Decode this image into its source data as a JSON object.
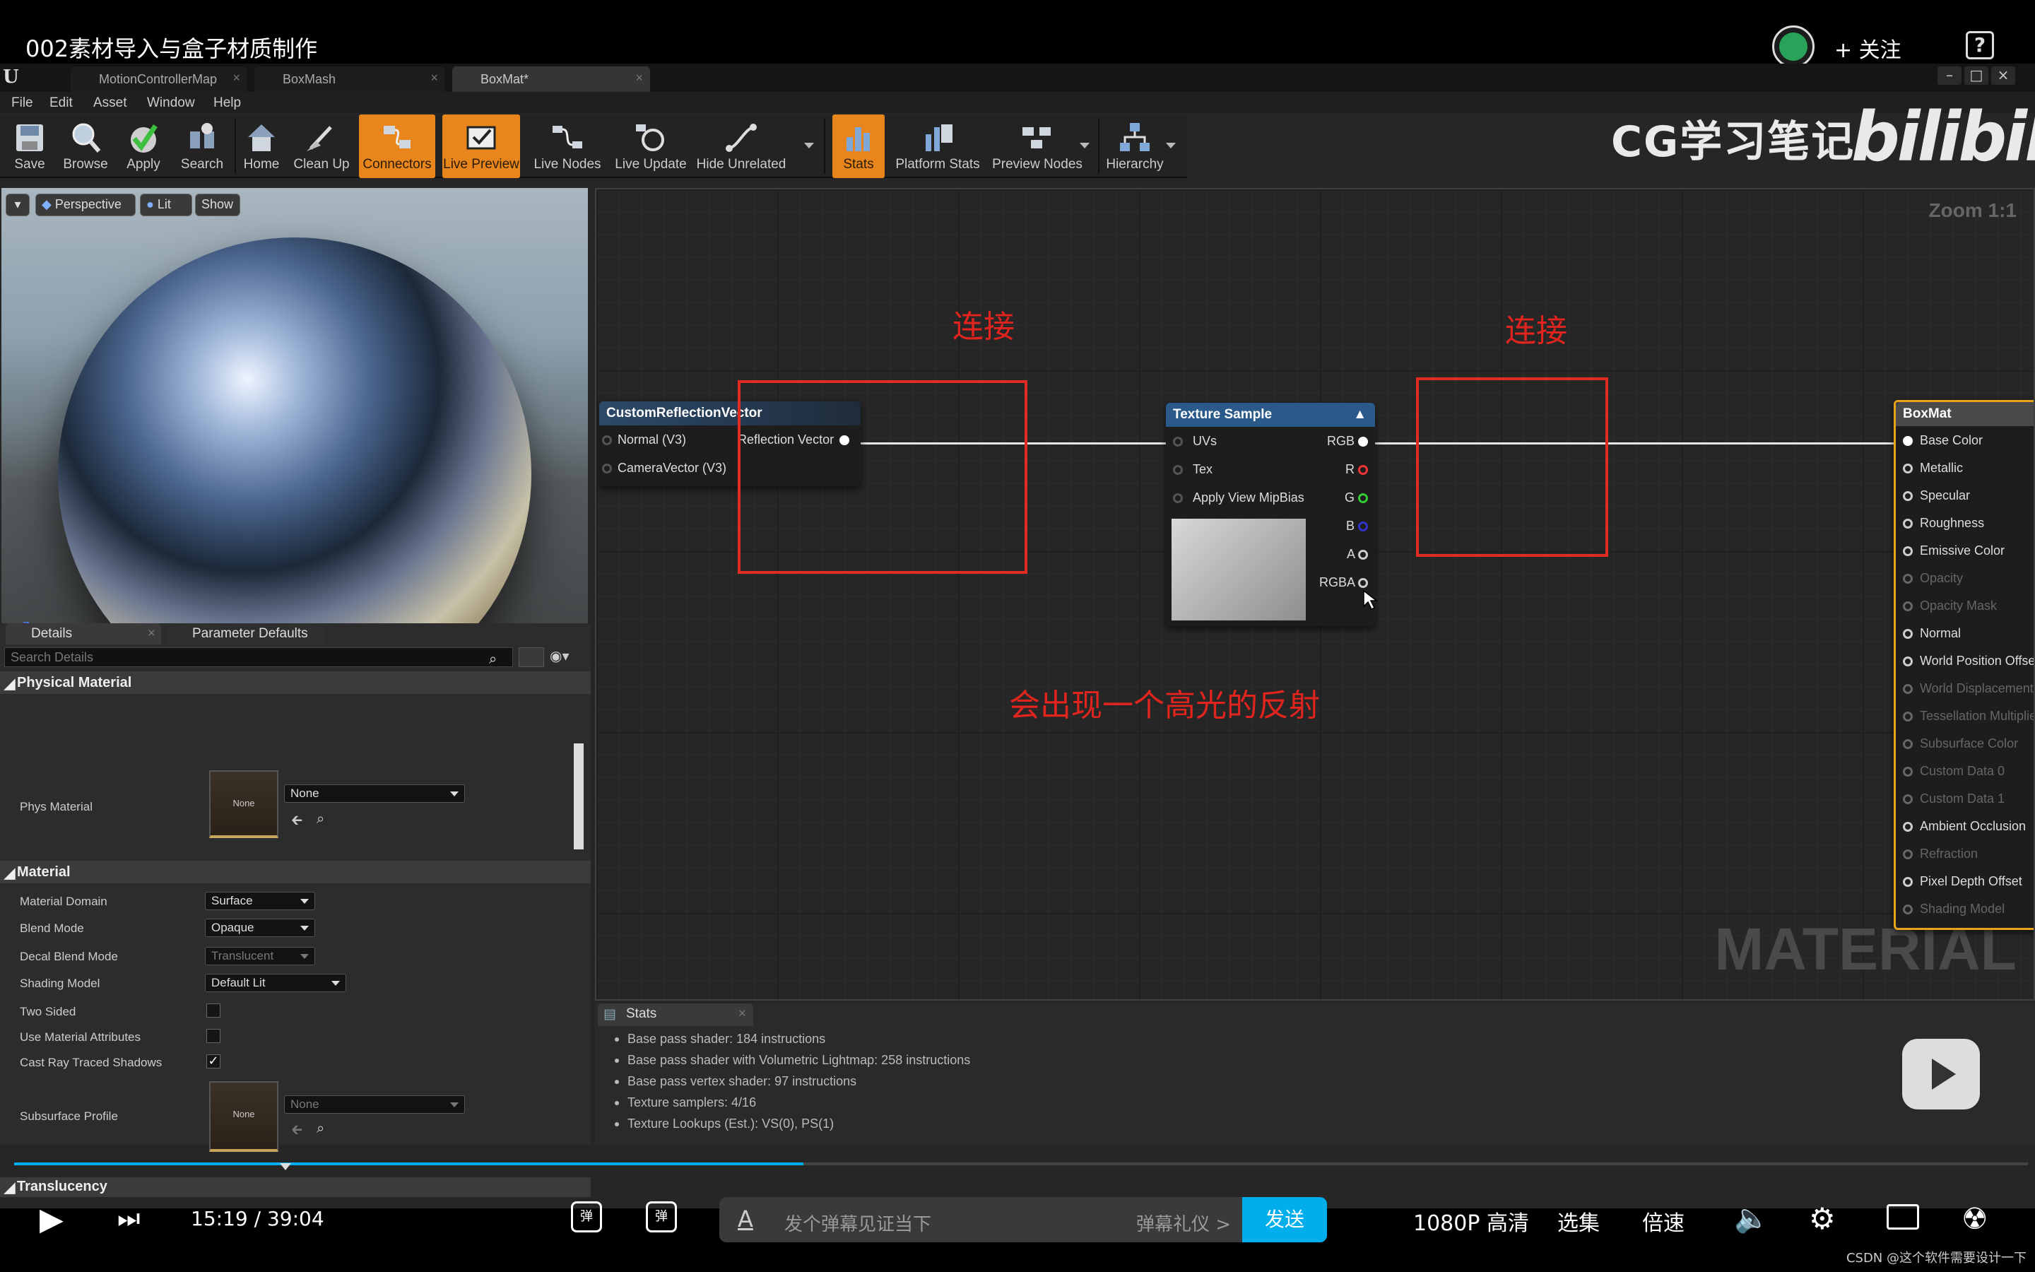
{
  "video": {
    "title": "002素材导入与盒子材质制作",
    "follow_label": "+ 关注",
    "help": "?",
    "brand": "CG学习笔记",
    "bili": "bilibili",
    "time_current": "15:19",
    "time_sep": "/",
    "time_total": "39:04",
    "progress": 0.392,
    "danmaku_placeholder": "发个弹幕见证当下",
    "danmaku_etiquette": "弹幕礼仪 >",
    "send": "发送",
    "quality": "1080P 高清",
    "episodes": "选集",
    "speed": "倍速",
    "credit": "CSDN @这个软件需要设计一下",
    "accent": "#00aeec"
  },
  "editor": {
    "tabs": [
      {
        "label": "MotionControllerMap"
      },
      {
        "label": "BoxMash"
      },
      {
        "label": "BoxMat*"
      }
    ],
    "menu": [
      "File",
      "Edit",
      "Asset",
      "Window",
      "Help"
    ],
    "toolbar": [
      {
        "label": "Save",
        "icon": "save-icon"
      },
      {
        "label": "Browse",
        "icon": "browse-icon"
      },
      {
        "label": "Apply",
        "icon": "apply-icon"
      },
      {
        "label": "Search",
        "icon": "search-icon"
      },
      {
        "label": "Home",
        "icon": "home-icon"
      },
      {
        "label": "Clean Up",
        "icon": "clean-up-icon"
      },
      {
        "label": "Connectors",
        "icon": "connectors-icon"
      },
      {
        "label": "Live Preview",
        "icon": "live-preview-icon"
      },
      {
        "label": "Live Nodes",
        "icon": "live-nodes-icon"
      },
      {
        "label": "Live Update",
        "icon": "live-update-icon"
      },
      {
        "label": "Hide Unrelated",
        "icon": "hide-unrelated-icon"
      },
      {
        "label": "Stats",
        "icon": "stats-icon"
      },
      {
        "label": "Platform Stats",
        "icon": "platform-stats-icon"
      },
      {
        "label": "Preview Nodes",
        "icon": "preview-nodes-icon"
      },
      {
        "label": "Hierarchy",
        "icon": "hierarchy-icon"
      }
    ],
    "accent_active": "#e8851c",
    "viewport": {
      "perspective": "Perspective",
      "lit": "Lit",
      "show": "Show"
    },
    "details": {
      "tab_details": "Details",
      "tab_params": "Parameter Defaults",
      "search_placeholder": "Search Details",
      "cat_physical": "Physical Material",
      "phys_material": "Phys Material",
      "none": "None",
      "cat_material": "Material",
      "material_domain": "Material Domain",
      "material_domain_value": "Surface",
      "blend_mode": "Blend Mode",
      "blend_mode_value": "Opaque",
      "decal_blend_mode": "Decal Blend Mode",
      "decal_blend_mode_value": "Translucent",
      "shading_model": "Shading Model",
      "shading_model_value": "Default Lit",
      "two_sided": "Two Sided",
      "use_material_attributes": "Use Material Attributes",
      "cast_ray_traced_shadows": "Cast Ray Traced Shadows",
      "subsurface_profile": "Subsurface Profile",
      "cat_translucency": "Translucency"
    },
    "graph": {
      "zoom": "Zoom 1:1",
      "watermark": "MATERIAL",
      "reflection_node": {
        "title": "CustomReflectionVector",
        "in1": "Normal (V3)",
        "in2": "CameraVector (V3)",
        "out": "Reflection Vector"
      },
      "texture_node": {
        "title": "Texture Sample",
        "in1": "UVs",
        "in2": "Tex",
        "in3": "Apply View MipBias",
        "outs": [
          "RGB",
          "R",
          "G",
          "B",
          "A",
          "RGBA"
        ]
      },
      "result_node": {
        "title": "BoxMat",
        "pins": [
          {
            "label": "Base Color",
            "enabled": true
          },
          {
            "label": "Metallic",
            "enabled": true
          },
          {
            "label": "Specular",
            "enabled": true
          },
          {
            "label": "Roughness",
            "enabled": true
          },
          {
            "label": "Emissive Color",
            "enabled": true
          },
          {
            "label": "Opacity",
            "enabled": false
          },
          {
            "label": "Opacity Mask",
            "enabled": false
          },
          {
            "label": "Normal",
            "enabled": true
          },
          {
            "label": "World Position Offset",
            "enabled": true
          },
          {
            "label": "World Displacement",
            "enabled": false
          },
          {
            "label": "Tessellation Multiplier",
            "enabled": false
          },
          {
            "label": "Subsurface Color",
            "enabled": false
          },
          {
            "label": "Custom Data 0",
            "enabled": false
          },
          {
            "label": "Custom Data 1",
            "enabled": false
          },
          {
            "label": "Ambient Occlusion",
            "enabled": true
          },
          {
            "label": "Refraction",
            "enabled": false
          },
          {
            "label": "Pixel Depth Offset",
            "enabled": true
          },
          {
            "label": "Shading Model",
            "enabled": false
          }
        ]
      },
      "annotation_connect_1": "连接",
      "annotation_connect_2": "连接",
      "annotation_reflect": "会出现一个高光的反射",
      "annotation_color": "#e2241e"
    },
    "stats": {
      "tab": "Stats",
      "lines": [
        "Base pass shader: 184 instructions",
        "Base pass shader with Volumetric Lightmap: 258 instructions",
        "Base pass vertex shader: 97 instructions",
        "Texture samplers: 4/16",
        "Texture Lookups (Est.): VS(0), PS(1)"
      ]
    }
  }
}
